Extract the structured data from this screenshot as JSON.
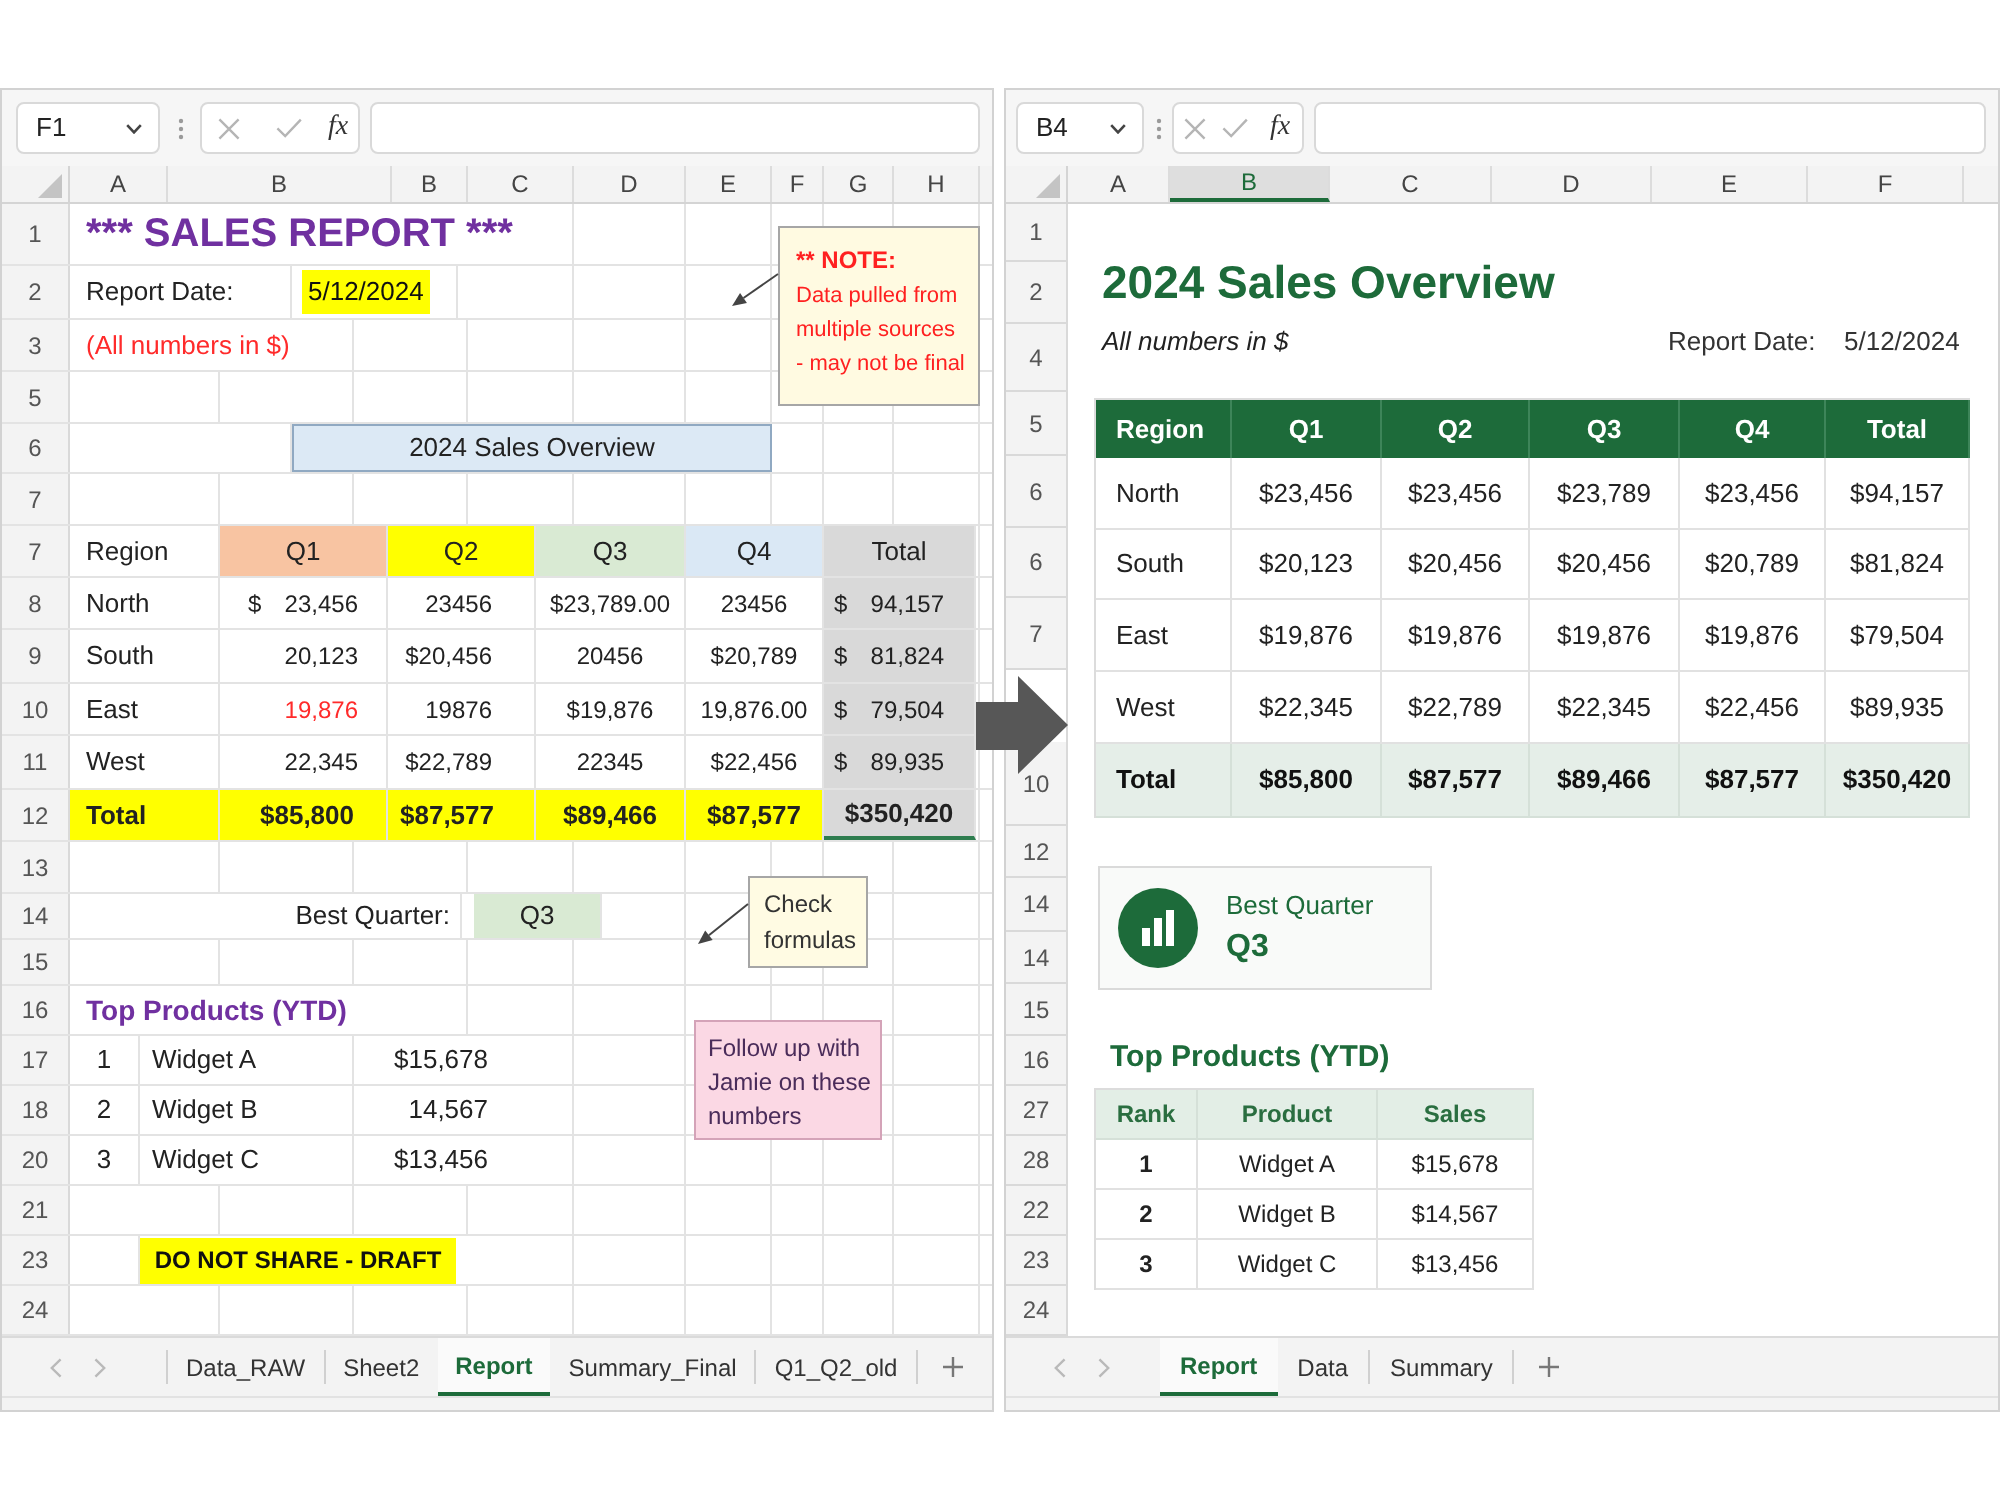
{
  "left_window": {
    "name_box": "F1",
    "function_button": "fx",
    "column_headers": [
      {
        "label": "A",
        "selected": false
      },
      {
        "label": "B",
        "selected": false
      },
      {
        "label": "B",
        "selected": false
      },
      {
        "label": "C",
        "selected": false
      },
      {
        "label": "D",
        "selected": false
      },
      {
        "label": "E",
        "selected": false
      },
      {
        "label": "F",
        "selected": false
      },
      {
        "label": "G",
        "selected": false
      },
      {
        "label": "H",
        "selected": false
      }
    ],
    "row_headers": [
      "1",
      "2",
      "3",
      "5",
      "6",
      "7",
      "7",
      "8",
      "9",
      "10",
      "11",
      "12",
      "13",
      "14",
      "15",
      "16",
      "17",
      "18",
      "20",
      "21",
      "23",
      "24"
    ],
    "title": "*** SALES REPORT ***",
    "report_date": {
      "label": "Report Date:",
      "value": "5/12/2024"
    },
    "currency_note": "(All numbers in $)",
    "overview_box": "2024 Sales Overview",
    "sales_table": {
      "columns": [
        {
          "label": "Region"
        },
        {
          "label": "Q1",
          "color": "#f8c4a2"
        },
        {
          "label": "Q2",
          "color": "#ffff00"
        },
        {
          "label": "Q3",
          "color": "#d9ead3"
        },
        {
          "label": "Q4",
          "color": "#dae8f5"
        },
        {
          "label": "Total",
          "color": "#d9d9d9"
        }
      ],
      "rows": [
        {
          "cells": [
            {
              "text": "North"
            },
            {
              "symbol": "$",
              "text": "23,456"
            },
            {
              "text": "23456"
            },
            {
              "text": "$23,789.00"
            },
            {
              "text": "23456"
            },
            {
              "symbol": "$",
              "text": "94,157"
            }
          ]
        },
        {
          "cells": [
            {
              "text": "South"
            },
            {
              "text": "20,123"
            },
            {
              "text": "$20,456"
            },
            {
              "text": "20456"
            },
            {
              "text": "$20,789"
            },
            {
              "symbol": "$",
              "text": "81,824"
            }
          ]
        },
        {
          "cells": [
            {
              "text": "East"
            },
            {
              "text": "19,876",
              "color": "#ff2b2b"
            },
            {
              "text": "19876"
            },
            {
              "text": "$19,876"
            },
            {
              "text": "19,876.00"
            },
            {
              "symbol": "$",
              "text": "79,504"
            }
          ]
        },
        {
          "cells": [
            {
              "text": "West"
            },
            {
              "text": "22,345"
            },
            {
              "text": "$22,789"
            },
            {
              "text": "22345"
            },
            {
              "text": "$22,456"
            },
            {
              "symbol": "$",
              "text": "89,935"
            }
          ]
        }
      ],
      "total_row": [
        "Total",
        "$85,800",
        "$87,577",
        "$89,466",
        "$87,577",
        "$350,420"
      ]
    },
    "best_quarter": {
      "label": "Best Quarter:",
      "value": "Q3"
    },
    "top_products": {
      "title": "Top Products (YTD)",
      "rows": [
        {
          "rank": "1",
          "product": "Widget A",
          "sales": "$15,678"
        },
        {
          "rank": "2",
          "product": "Widget B",
          "sales": "14,567"
        },
        {
          "rank": "3",
          "product": "Widget C",
          "sales": "$13,456"
        }
      ]
    },
    "draft_banner": "DO NOT SHARE - DRAFT",
    "comments": [
      {
        "kind": "warning",
        "title": "** NOTE:",
        "text": "Data pulled from\nmultiple sources\n- may not be final"
      },
      {
        "kind": "callout",
        "text": "Check\nformulas"
      },
      {
        "kind": "sticky",
        "text": "Follow up with\nJamie on these\nnumbers"
      }
    ],
    "sheet_tabs": [
      {
        "label": "Data_RAW",
        "selected": false
      },
      {
        "label": "Sheet2",
        "selected": false
      },
      {
        "label": "Report",
        "selected": true
      },
      {
        "label": "Summary_Final",
        "selected": false
      },
      {
        "label": "Q1_Q2_old",
        "selected": false
      }
    ]
  },
  "right_window": {
    "name_box": "B4",
    "function_button": "fx",
    "column_headers": [
      {
        "label": "A",
        "selected": false
      },
      {
        "label": "B",
        "selected": true
      },
      {
        "label": "C",
        "selected": false
      },
      {
        "label": "D",
        "selected": false
      },
      {
        "label": "E",
        "selected": false
      },
      {
        "label": "F",
        "selected": false
      }
    ],
    "row_headers": [
      "1",
      "2",
      "4",
      "5",
      "6",
      "6",
      "7",
      "10",
      "12",
      "14",
      "14",
      "15",
      "16",
      "27",
      "28",
      "22",
      "23",
      "24"
    ],
    "title": "2024 Sales Overview",
    "currency_note": "All numbers in $",
    "report_date": {
      "label": "Report Date:",
      "value": "5/12/2024"
    },
    "sales_table": {
      "columns": [
        "Region",
        "Q1",
        "Q2",
        "Q3",
        "Q4",
        "Total"
      ],
      "rows": [
        [
          "North",
          "$23,456",
          "$23,456",
          "$23,789",
          "$23,456",
          "$94,157"
        ],
        [
          "South",
          "$20,123",
          "$20,456",
          "$20,456",
          "$20,789",
          "$81,824"
        ],
        [
          "East",
          "$19,876",
          "$19,876",
          "$19,876",
          "$19,876",
          "$79,504"
        ],
        [
          "West",
          "$22,345",
          "$22,789",
          "$22,345",
          "$22,456",
          "$89,935"
        ]
      ],
      "total_row": [
        "Total",
        "$85,800",
        "$87,577",
        "$89,466",
        "$87,577",
        "$350,420"
      ]
    },
    "best_quarter": {
      "label": "Best Quarter",
      "value": "Q3"
    },
    "top_products": {
      "title": "Top Products (YTD)",
      "columns": [
        "Rank",
        "Product",
        "Sales"
      ],
      "rows": [
        [
          "1",
          "Widget A",
          "$15,678"
        ],
        [
          "2",
          "Widget B",
          "$14,567"
        ],
        [
          "3",
          "Widget C",
          "$13,456"
        ]
      ]
    },
    "sheet_tabs": [
      {
        "label": "Report",
        "selected": true
      },
      {
        "label": "Data",
        "selected": false
      },
      {
        "label": "Summary",
        "selected": false
      }
    ]
  }
}
